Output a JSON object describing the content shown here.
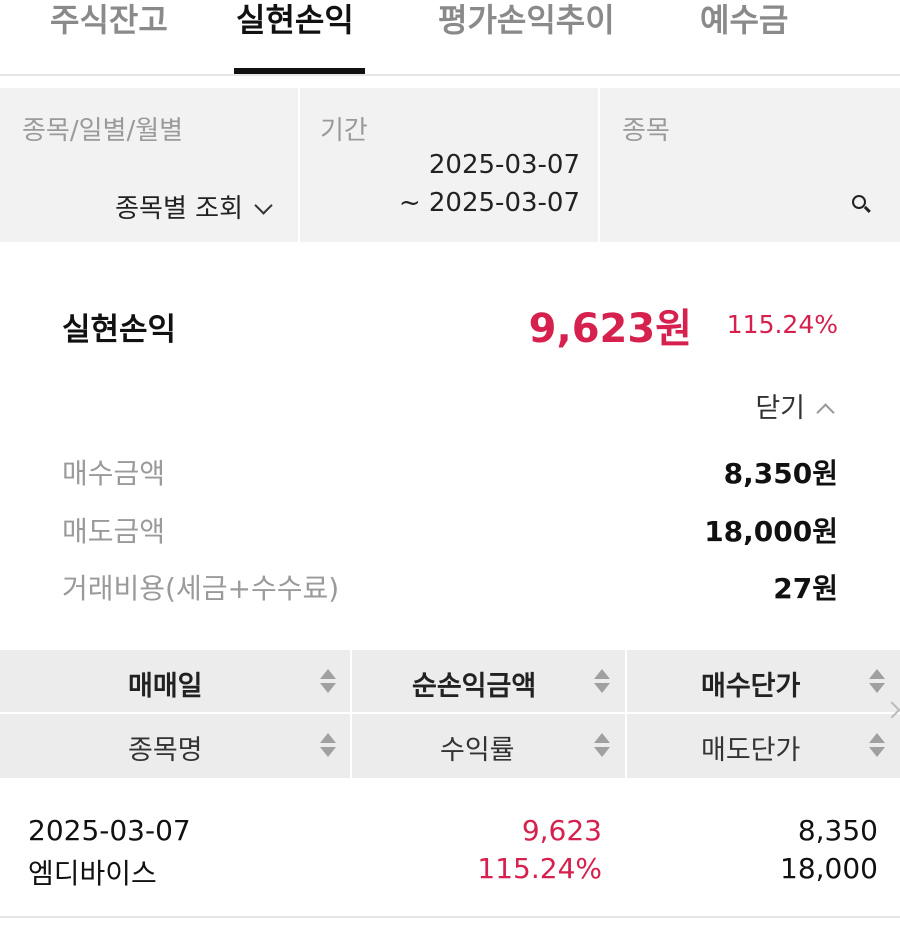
{
  "tabs": [
    {
      "label": "주식잔고",
      "active": false
    },
    {
      "label": "실현손익",
      "active": true
    },
    {
      "label": "평가손익추이",
      "active": false
    },
    {
      "label": "예수금",
      "active": false
    }
  ],
  "filter": {
    "view_type": {
      "label": "종목/일별/월별",
      "value": "종목별 조회"
    },
    "period": {
      "label": "기간",
      "from": "2025-03-07",
      "to": "~ 2025-03-07"
    },
    "stock": {
      "label": "종목"
    }
  },
  "summary": {
    "title": "실현손익",
    "amount": "9,623원",
    "rate": "115.24%",
    "toggle_label": "닫기",
    "details": [
      {
        "label": "매수금액",
        "value": "8,350원"
      },
      {
        "label": "매도금액",
        "value": "18,000원"
      },
      {
        "label": "거래비용(세금+수수료)",
        "value": "27원"
      }
    ]
  },
  "table": {
    "header_row1": [
      "매매일",
      "순손익금액",
      "매수단가"
    ],
    "header_row2": [
      "종목명",
      "수익률",
      "매도단가"
    ],
    "rows": [
      {
        "date": "2025-03-07",
        "name": "엠디바이스",
        "net_profit": "9,623",
        "return_rate": "115.24%",
        "buy_price": "8,350",
        "sell_price": "18,000"
      }
    ]
  },
  "colors": {
    "accent": "#d6204e",
    "header_bg": "#ececec",
    "filter_bg": "#f2f2f2"
  }
}
